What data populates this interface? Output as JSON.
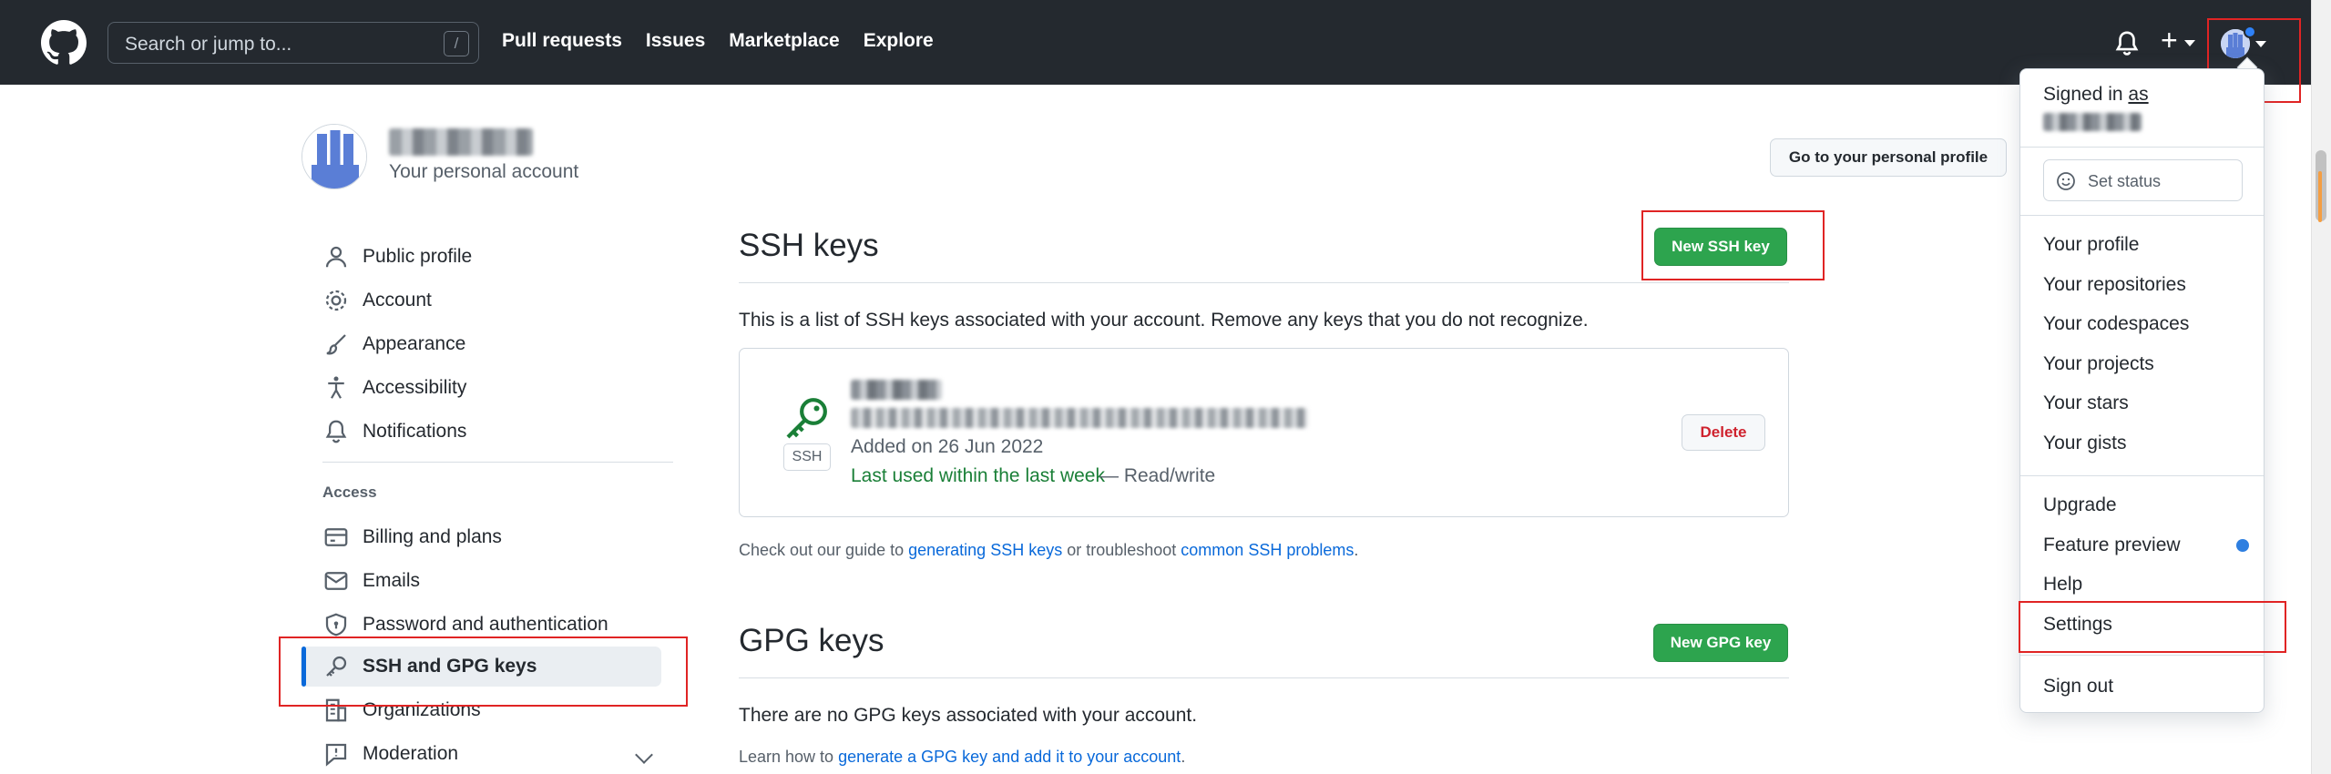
{
  "header": {
    "search_placeholder": "Search or jump to...",
    "search_shortcut": "/",
    "nav": [
      "Pull requests",
      "Issues",
      "Marketplace",
      "Explore"
    ]
  },
  "account": {
    "subtitle": "Your personal account",
    "profile_button": "Go to your personal profile"
  },
  "sidebar": {
    "items": [
      {
        "label": "Public profile",
        "icon": "person-icon"
      },
      {
        "label": "Account",
        "icon": "gear-icon"
      },
      {
        "label": "Appearance",
        "icon": "paintbrush-icon"
      },
      {
        "label": "Accessibility",
        "icon": "accessibility-icon"
      },
      {
        "label": "Notifications",
        "icon": "bell-icon"
      }
    ],
    "access_heading": "Access",
    "access_items": [
      {
        "label": "Billing and plans",
        "icon": "credit-card-icon"
      },
      {
        "label": "Emails",
        "icon": "mail-icon"
      },
      {
        "label": "Password and authentication",
        "icon": "shield-lock-icon"
      },
      {
        "label": "SSH and GPG keys",
        "icon": "key-icon",
        "active": true
      },
      {
        "label": "Organizations",
        "icon": "organization-icon"
      },
      {
        "label": "Moderation",
        "icon": "report-icon"
      }
    ]
  },
  "ssh": {
    "heading": "SSH keys",
    "new_button": "New SSH key",
    "description": "This is a list of SSH keys associated with your account. Remove any keys that you do not recognize.",
    "key": {
      "type_tag": "SSH",
      "added": "Added on 26 Jun 2022",
      "last_used": "Last used within the last week",
      "access": "— Read/write",
      "delete_button": "Delete"
    },
    "guide_prefix": "Check out our guide to ",
    "guide_link1": "generating SSH keys",
    "guide_mid": " or troubleshoot ",
    "guide_link2": "common SSH problems",
    "guide_suffix": "."
  },
  "gpg": {
    "heading": "GPG keys",
    "new_button": "New GPG key",
    "empty": "There are no GPG keys associated with your account.",
    "learn_prefix": "Learn how to ",
    "learn_link": "generate a GPG key and add it to your account",
    "learn_suffix": "."
  },
  "dropdown": {
    "signed_in": "Signed in",
    "signed_as": "as",
    "set_status": "Set status",
    "group1": [
      "Your profile",
      "Your repositories",
      "Your codespaces",
      "Your projects",
      "Your stars",
      "Your gists"
    ],
    "group2": [
      "Upgrade",
      "Feature preview",
      "Help",
      "Settings"
    ],
    "sign_out": "Sign out"
  },
  "colors": {
    "header_bg": "#24292f",
    "primary_green": "#2da44e",
    "link_blue": "#0969da",
    "active_bar": "#0969da",
    "annotation_red": "#e02424"
  }
}
